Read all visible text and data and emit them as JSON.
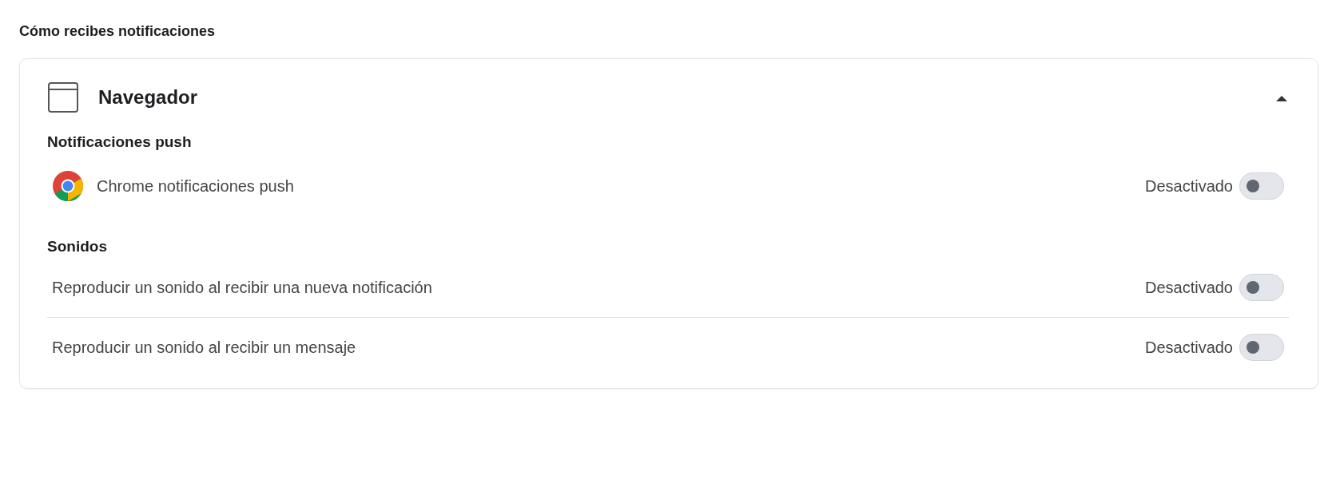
{
  "heading": "Cómo recibes notificaciones",
  "panel": {
    "title": "Navegador",
    "expanded": true,
    "sections": [
      {
        "title": "Notificaciones push",
        "items": [
          {
            "kind": "app",
            "label": "Chrome notificaciones push",
            "status": "Desactivado",
            "on": false
          }
        ]
      },
      {
        "title": "Sonidos",
        "items": [
          {
            "kind": "plain",
            "label": "Reproducir un sonido al recibir una nueva notificación",
            "status": "Desactivado",
            "on": false
          },
          {
            "kind": "plain",
            "label": "Reproducir un sonido al recibir un mensaje",
            "status": "Desactivado",
            "on": false
          }
        ]
      }
    ]
  }
}
